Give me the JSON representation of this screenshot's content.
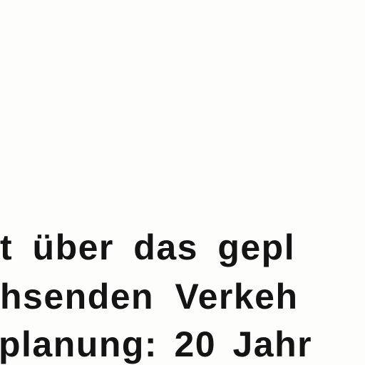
{
  "document": {
    "lines": [
      "t über das gepl",
      "hsenden Verkeh",
      "planung: 20 Jahr"
    ]
  }
}
